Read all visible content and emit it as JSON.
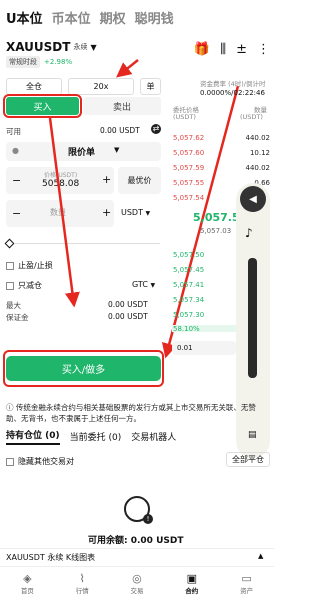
{
  "top_tabs": [
    "U本位",
    "币本位",
    "期权",
    "聪明钱"
  ],
  "pair": {
    "name": "XAUUSDT",
    "type": "永续",
    "session": "常规时段",
    "change": "+2.98%"
  },
  "margin_mode": "全仓",
  "leverage": "20x",
  "position_mode": "单",
  "side_tabs": {
    "buy": "买入",
    "sell": "卖出"
  },
  "available": {
    "label": "可用",
    "value": "0.00 USDT"
  },
  "order_type": "限价单",
  "price": {
    "label": "价格(USDT)",
    "value": "5058.08",
    "best": "最优价"
  },
  "quantity": {
    "placeholder": "数量",
    "unit": "USDT"
  },
  "tp_sl": "止盈/止损",
  "reduce_only": "只减仓",
  "tif": "GTC",
  "max": {
    "label": "最大",
    "value": "0.00 USDT"
  },
  "margin": {
    "label": "保证金",
    "value": "0.00 USDT"
  },
  "submit": "买入/做多",
  "funding": {
    "label": "资金费率 (4时)/倒计时",
    "value": "0.0000%/02:22:46"
  },
  "orderbook_headers": {
    "price": "委托价格",
    "price_unit": "(USDT)",
    "qty": "数量",
    "qty_unit": "(USDT)"
  },
  "asks": [
    {
      "price": "5,057.62",
      "qty": "440.02"
    },
    {
      "price": "5,057.60",
      "qty": "10.12"
    },
    {
      "price": "5,057.59",
      "qty": "440.02"
    },
    {
      "price": "5,057.55",
      "qty": "0.66"
    },
    {
      "price": "5,057.54",
      "qty": ""
    }
  ],
  "last_price": "5,057.5",
  "mark_price": "5,057.03",
  "bids": [
    {
      "price": "5,057.50"
    },
    {
      "price": "5,057.45"
    },
    {
      "price": "5,057.41"
    },
    {
      "price": "5,057.34"
    },
    {
      "price": "5,057.30"
    }
  ],
  "depth_ratio": "58.10%",
  "tick": "0.01",
  "notice": "传统金融永续合约与相关基础股票的发行方或其上市交易所无关联、无赞助、无背书，也不隶属于上述任何一方。",
  "bottom_tabs": [
    "持有仓位 (0)",
    "当前委托 (0)",
    "交易机器人"
  ],
  "hide_other": "隐藏其他交易对",
  "close_all": "全部平仓",
  "available_balance": "可用余额: 0.00 USDT",
  "chart_bar": "XAUUSDT 永续 K线图表",
  "nav": [
    "首页",
    "行情",
    "交易",
    "合约",
    "资产"
  ]
}
